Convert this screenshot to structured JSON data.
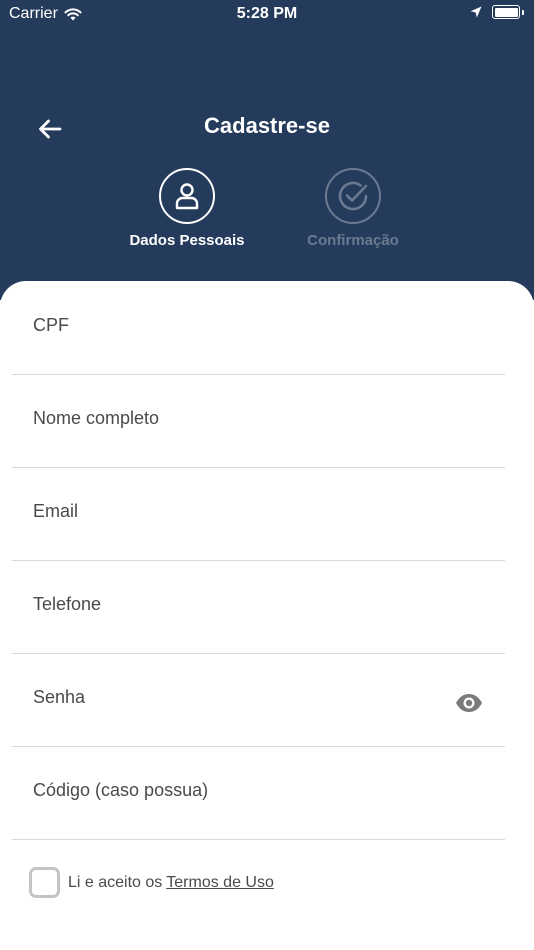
{
  "status_bar": {
    "carrier": "Carrier",
    "time": "5:28 PM"
  },
  "header": {
    "title": "Cadastre-se",
    "background_color": "#253b5c",
    "back_icon": "arrow-left-icon"
  },
  "steps": [
    {
      "label": "Dados Pessoais",
      "icon": "user-icon",
      "active": true
    },
    {
      "label": "Confirmação",
      "icon": "check-circle-icon",
      "active": false
    }
  ],
  "form": {
    "fields": [
      {
        "placeholder": "CPF",
        "value": ""
      },
      {
        "placeholder": "Nome completo",
        "value": ""
      },
      {
        "placeholder": "Email",
        "value": ""
      },
      {
        "placeholder": "Telefone",
        "value": ""
      },
      {
        "placeholder": "Senha",
        "value": "",
        "icon": "eye-icon"
      },
      {
        "placeholder": "Código (caso possua)",
        "value": ""
      }
    ]
  },
  "terms": {
    "text": "Li e aceito os",
    "link": "Termos de Uso",
    "checked": false
  }
}
